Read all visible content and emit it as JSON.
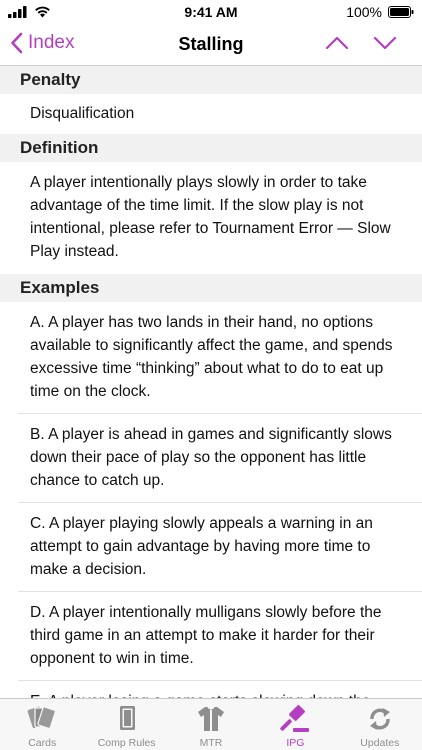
{
  "status": {
    "time": "9:41 AM",
    "battery": "100%"
  },
  "nav": {
    "back_label": "Index",
    "title": "Stalling"
  },
  "sections": {
    "penalty": {
      "header": "Penalty",
      "text": "Disqualification"
    },
    "definition": {
      "header": "Definition",
      "text": "A player intentionally plays slowly in order to take advantage of the time limit. If the slow play is not intentional, please refer to Tournament Error — Slow Play instead."
    },
    "examples": {
      "header": "Examples",
      "items": [
        "A. A player has two lands in their hand, no options available to significantly affect the game, and spends excessive time “thinking” about what to do to eat up time on the clock.",
        "B. A player is ahead in games and significantly slows down their pace of play so the opponent has little chance to catch up.",
        "C. A player playing slowly appeals a warning in an attempt to gain advantage by having more time to make a decision.",
        "D. A player intentionally mulligans slowly before the third game in an attempt to make it harder for their opponent to win in time.",
        "E. A player losing a game starts slowing down the pace of play in an attempt to run out the clock."
      ]
    }
  },
  "tabs": [
    {
      "label": "Cards",
      "icon": "cards-icon"
    },
    {
      "label": "Comp Rules",
      "icon": "comp-rules-icon"
    },
    {
      "label": "MTR",
      "icon": "shirt-icon"
    },
    {
      "label": "IPG",
      "icon": "gavel-icon",
      "active": true
    },
    {
      "label": "Updates",
      "icon": "refresh-icon"
    }
  ],
  "colors": {
    "accent": "#b43fc3",
    "section_bg": "#f1f1f1",
    "tab_inactive": "#8e8e8e"
  }
}
